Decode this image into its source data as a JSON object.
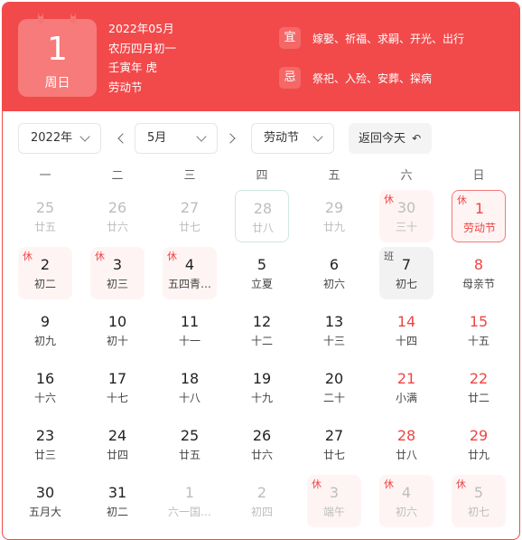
{
  "header": {
    "big_day": "1",
    "big_weekday": "周日",
    "info_lines": [
      "2022年05月",
      "农历四月初一",
      "壬寅年 虎",
      "劳动节"
    ],
    "yi_label": "宜",
    "yi_text": "嫁娶、祈福、求嗣、开光、出行",
    "ji_label": "忌",
    "ji_text": "祭祀、入殓、安葬、探病"
  },
  "toolbar": {
    "year_value": "2022年",
    "month_value": "5月",
    "holiday_value": "劳动节",
    "today_label": "返回今天",
    "today_icon": "undo-icon"
  },
  "weekdays": [
    "一",
    "二",
    "三",
    "四",
    "五",
    "六",
    "日"
  ],
  "colors": {
    "accent": "#f24a4b",
    "holiday_red": "#ef4444"
  },
  "days": [
    {
      "num": "25",
      "sub": "廿五",
      "state": "faded"
    },
    {
      "num": "26",
      "sub": "廿六",
      "state": "faded"
    },
    {
      "num": "27",
      "sub": "廿七",
      "state": "faded"
    },
    {
      "num": "28",
      "sub": "廿八",
      "state": "faded hover"
    },
    {
      "num": "29",
      "sub": "廿九",
      "state": "faded"
    },
    {
      "num": "30",
      "sub": "三十",
      "state": "faded holiday",
      "badge": "休"
    },
    {
      "num": "1",
      "sub": "劳动节",
      "state": "red today",
      "badge": "休"
    },
    {
      "num": "2",
      "sub": "初二",
      "state": "holiday",
      "badge": "休"
    },
    {
      "num": "3",
      "sub": "初三",
      "state": "holiday",
      "badge": "休"
    },
    {
      "num": "4",
      "sub": "五四青…",
      "state": "holiday",
      "badge": "休"
    },
    {
      "num": "5",
      "sub": "立夏",
      "state": ""
    },
    {
      "num": "6",
      "sub": "初六",
      "state": ""
    },
    {
      "num": "7",
      "sub": "初七",
      "state": "workday",
      "badge": "班"
    },
    {
      "num": "8",
      "sub": "母亲节",
      "state": "weekend"
    },
    {
      "num": "9",
      "sub": "初九",
      "state": ""
    },
    {
      "num": "10",
      "sub": "初十",
      "state": ""
    },
    {
      "num": "11",
      "sub": "十一",
      "state": ""
    },
    {
      "num": "12",
      "sub": "十二",
      "state": ""
    },
    {
      "num": "13",
      "sub": "十三",
      "state": ""
    },
    {
      "num": "14",
      "sub": "十四",
      "state": "weekend"
    },
    {
      "num": "15",
      "sub": "十五",
      "state": "weekend"
    },
    {
      "num": "16",
      "sub": "十六",
      "state": ""
    },
    {
      "num": "17",
      "sub": "十七",
      "state": ""
    },
    {
      "num": "18",
      "sub": "十八",
      "state": ""
    },
    {
      "num": "19",
      "sub": "十九",
      "state": ""
    },
    {
      "num": "20",
      "sub": "二十",
      "state": ""
    },
    {
      "num": "21",
      "sub": "小满",
      "state": "weekend"
    },
    {
      "num": "22",
      "sub": "廿二",
      "state": "weekend"
    },
    {
      "num": "23",
      "sub": "廿三",
      "state": ""
    },
    {
      "num": "24",
      "sub": "廿四",
      "state": ""
    },
    {
      "num": "25",
      "sub": "廿五",
      "state": ""
    },
    {
      "num": "26",
      "sub": "廿六",
      "state": ""
    },
    {
      "num": "27",
      "sub": "廿七",
      "state": ""
    },
    {
      "num": "28",
      "sub": "廿八",
      "state": "weekend"
    },
    {
      "num": "29",
      "sub": "廿九",
      "state": "weekend"
    },
    {
      "num": "30",
      "sub": "五月大",
      "state": ""
    },
    {
      "num": "31",
      "sub": "初二",
      "state": ""
    },
    {
      "num": "1",
      "sub": "六一国…",
      "state": "faded"
    },
    {
      "num": "2",
      "sub": "初四",
      "state": "faded"
    },
    {
      "num": "3",
      "sub": "端午",
      "state": "faded holiday",
      "badge": "休"
    },
    {
      "num": "4",
      "sub": "初六",
      "state": "faded holiday",
      "badge": "休"
    },
    {
      "num": "5",
      "sub": "初七",
      "state": "faded holiday",
      "badge": "休"
    }
  ]
}
